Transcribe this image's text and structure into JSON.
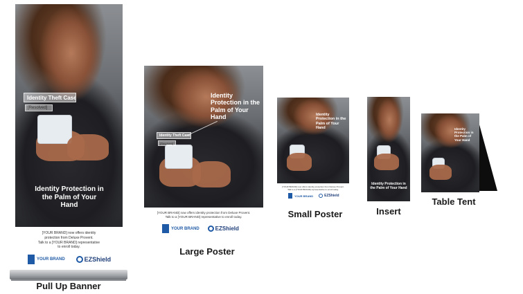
{
  "products": {
    "pull_up_banner": {
      "caption": "Pull Up Banner",
      "tag_title": "Identity Theft Case",
      "tag_sub": "[Resolved]",
      "headline": "Identity Protection in the Palm of Your Hand",
      "copy_line1": "[YOUR BRAND] now offers identity",
      "copy_line2": "protection from Deluxe Provent.",
      "copy_line3": "Talk to a [YOUR BRAND] representative",
      "copy_line4": "to enroll today."
    },
    "large_poster": {
      "caption": "Large Poster",
      "headline": "Identity Protection in the Palm of Your Hand",
      "tag_title": "Identity Theft Case",
      "tag_sub": "[Resolved]",
      "copy_line1": "[YOUR BRAND] now offers identity protection from Deluxe Provent.",
      "copy_line2": "Talk to a [YOUR BRAND] representative to enroll today."
    },
    "small_poster": {
      "caption": "Small Poster",
      "headline": "Identity Protection in the Palm of Your Hand",
      "copy_line1": "[YOUR BRAND] now offers identity protection from Deluxe Provent.",
      "copy_line2": "Talk to a [YOUR BRAND] representative to enroll today."
    },
    "insert": {
      "caption": "Insert",
      "headline": "Identity Protection in the Palm of Your Hand"
    },
    "table_tent": {
      "caption": "Table Tent",
      "headline": "Identity Protection in the Palm of Your Hand"
    }
  },
  "logos": {
    "brand": "YOUR BRAND",
    "ezshield": "EZShield"
  },
  "icons": {
    "brand_mark": "brand-logo-icon",
    "ezshield_mark": "ezshield-logo-icon"
  },
  "colors": {
    "brand_blue": "#1f5aa6",
    "text_dark": "#1a1a1a"
  }
}
